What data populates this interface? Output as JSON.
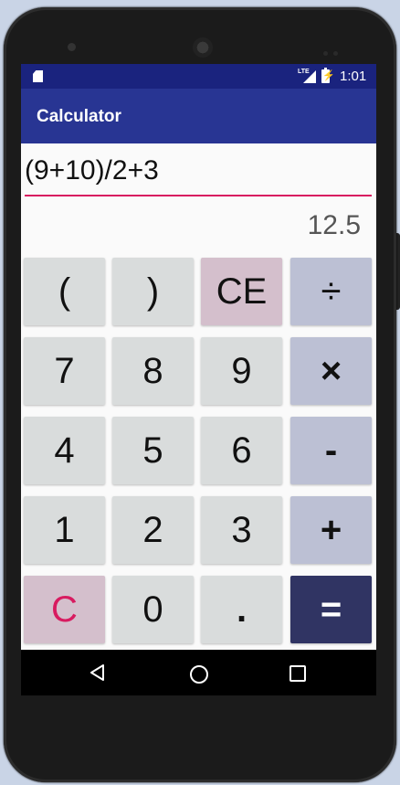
{
  "status_bar": {
    "network_label": "LTE",
    "time": "1:01"
  },
  "app_bar": {
    "title": "Calculator"
  },
  "display": {
    "expression": "(9+10)/2+3",
    "result": "12.5"
  },
  "keypad": {
    "rows": [
      [
        "(",
        ")",
        "CE",
        "÷"
      ],
      [
        "7",
        "8",
        "9",
        "×"
      ],
      [
        "4",
        "5",
        "6",
        "-"
      ],
      [
        "1",
        "2",
        "3",
        "+"
      ],
      [
        "C",
        "0",
        ".",
        "="
      ]
    ]
  },
  "colors": {
    "status_bar": "#1a237e",
    "app_bar": "#283593",
    "accent": "#d81b60",
    "digit_key": "#d9dcdc",
    "operator_key": "#bcc0d4",
    "clear_entry_key": "#d4bfcc",
    "equals_key": "#303463"
  },
  "icons": {
    "navigation": [
      "back-icon",
      "home-icon",
      "recents-icon"
    ]
  }
}
